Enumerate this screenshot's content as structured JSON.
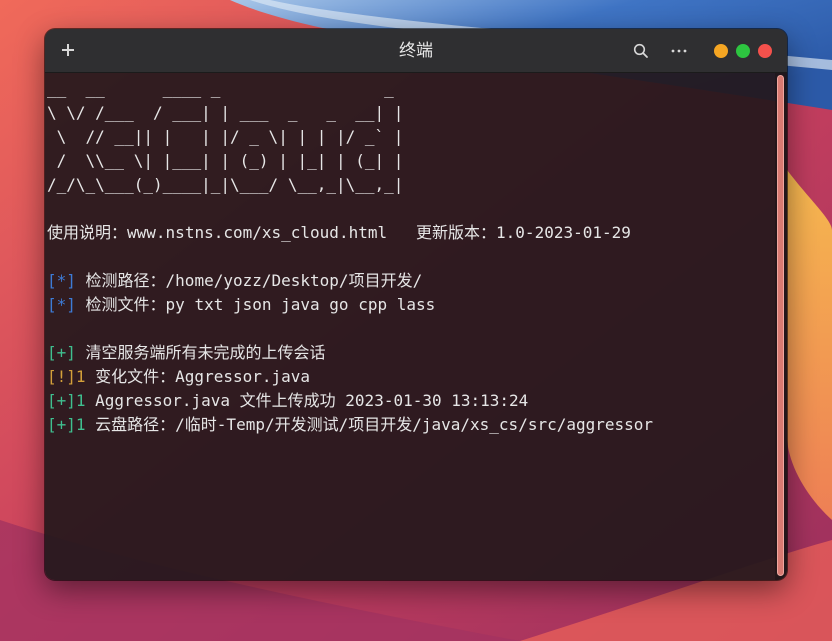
{
  "window": {
    "title": "终端"
  },
  "colors": {
    "prompt_info": "#3d7bd6",
    "prompt_ok": "#3fbf8f",
    "prompt_warn": "#d4a03a",
    "text": "#e6e6e6",
    "scroll_thumb": "#d97a72"
  },
  "icons": {
    "new_tab": "plus-icon",
    "search": "search-icon",
    "more": "more-horizontal-icon"
  },
  "terminal": {
    "banner": [
      "__  __      ____ _                 _",
      "\\ \\/ /___  / ___| | ___  _   _  __| |",
      " \\  // __|| |   | |/ _ \\| | | |/ _` |",
      " /  \\\\__ \\| |___| | (_) | |_| | (_| |",
      "/_/\\_\\___(_)____|_|\\___/ \\__,_|\\__,_|"
    ],
    "usage_label": "使用说明：",
    "usage_url": "www.nstns.com/xs_cloud.html",
    "version_label": "更新版本：",
    "version_value": "1.0-2023-01-29",
    "lines": [
      {
        "prefix": "[*]",
        "color": "blue",
        "text": " 检测路径：/home/yozz/Desktop/项目开发/"
      },
      {
        "prefix": "[*]",
        "color": "blue",
        "text": " 检测文件：py txt json java go cpp lass"
      },
      {
        "prefix": "",
        "color": "plain",
        "text": ""
      },
      {
        "prefix": "[+]",
        "color": "green",
        "text": " 清空服务端所有未完成的上传会话"
      },
      {
        "prefix": "[!]1",
        "color": "orange",
        "text": " 变化文件：Aggressor.java"
      },
      {
        "prefix": "[+]1",
        "color": "green",
        "text": " Aggressor.java 文件上传成功 2023-01-30 13:13:24"
      },
      {
        "prefix": "[+]1",
        "color": "green",
        "text": " 云盘路径：/临时-Temp/开发测试/项目开发/java/xs_cs/src/aggressor"
      }
    ]
  }
}
